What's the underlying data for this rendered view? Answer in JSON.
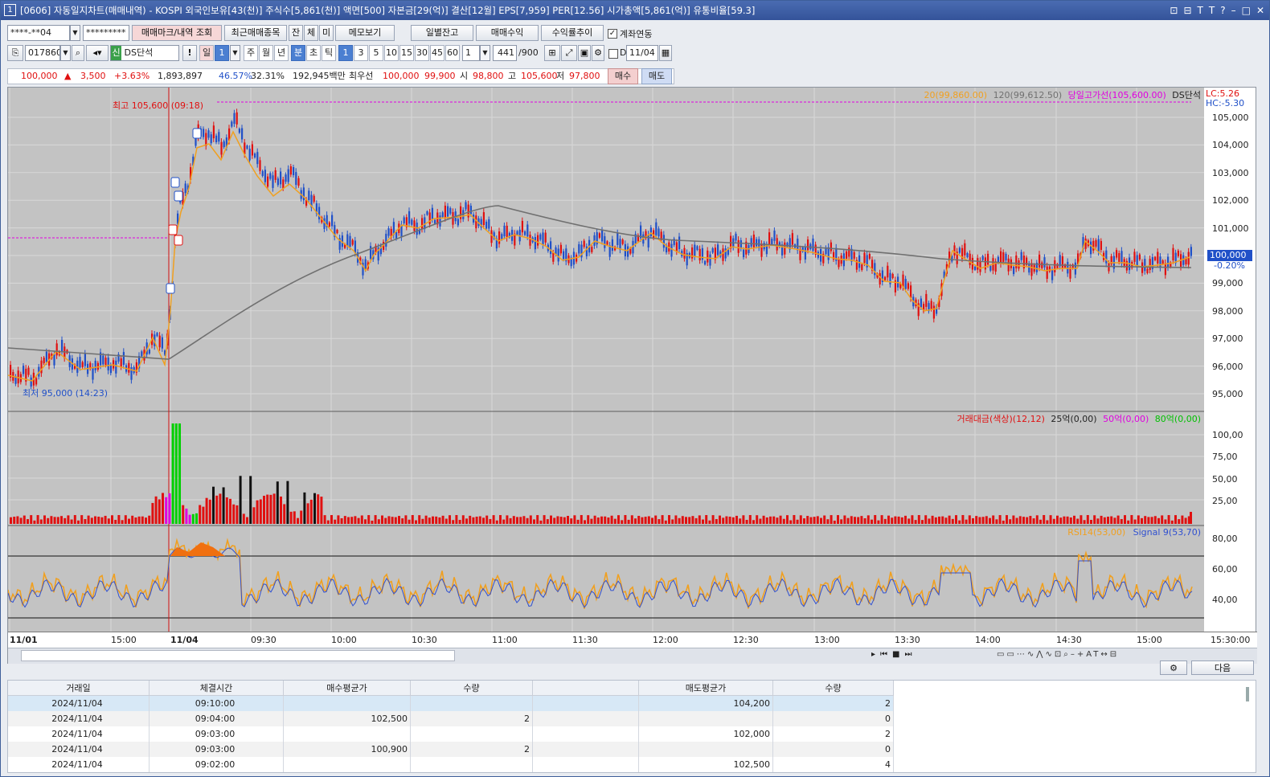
{
  "window": {
    "icon_num": "1",
    "title": "[0606] 자동일지차트(매매내역) - KOSPI 외국인보유[43(천)] 주식수[5,861(천)] 액면[500] 자본금[29(억)] 결산[12월] EPS[7,959] PER[12.56] 시가총액[5,861(억)] 유통비율[59.3]",
    "controls": [
      "⊡",
      "⊟",
      "T",
      "T",
      "?",
      "–",
      "□",
      "✕"
    ]
  },
  "toolbar1": {
    "account": "****-**04",
    "password": "*********",
    "buttons": [
      "매매마크/내역 조회",
      "최근매매종목",
      "잔",
      "체",
      "미",
      "메모보기"
    ],
    "right_buttons": [
      "일별잔고",
      "매매수익",
      "수익률추이"
    ],
    "link_label": "계좌연동",
    "link_checked": true
  },
  "toolbar2": {
    "code": "017860",
    "name": "DS단석",
    "name_badge": "신",
    "excl": "!",
    "periods": [
      "일",
      "1",
      "주",
      "월",
      "년",
      "분",
      "초",
      "틱"
    ],
    "active_period": "분",
    "minute_opts": [
      "1",
      "3",
      "5",
      "10",
      "15",
      "30",
      "45",
      "60"
    ],
    "active_minute": "1",
    "step": "1",
    "count": "441",
    "count_total": "/900",
    "d_label": "D",
    "date": "11/04"
  },
  "quote": {
    "price": "100,000",
    "arrow": "▲",
    "change": "3,500",
    "rate": "+3.63%",
    "volume": "1,893,897",
    "vol_ratio": "46.57%",
    "turnover": "32.31%",
    "amount": "192,945백만",
    "best_label": "최우선",
    "ask": "100,000",
    "bid": "99,900",
    "open_label": "시",
    "open": "98,800",
    "high_label": "고",
    "high": "105,600",
    "low_label": "저",
    "low": "97,800",
    "buy_btn": "매수",
    "sell_btn": "매도"
  },
  "chart": {
    "price_axis": [
      "105,000",
      "104,000",
      "103,000",
      "102,000",
      "101,000",
      "100,000",
      "99,000",
      "98,000",
      "97,000",
      "96,000",
      "95,000"
    ],
    "price_now": "100,000",
    "price_now_pct": "-0.20%",
    "lc_label": "LC:5.26",
    "hc_label": "HC:-5.30",
    "legend_ma20": "20(99,860.00)",
    "legend_ma120": "120(99,612.50)",
    "legend_prevhigh": "당일고가선(105,600.00)",
    "legend_name": "DS단석",
    "high_mark": "최고 105,600 (09:18)",
    "low_mark": "최저 95,000 (14:23)",
    "vol_axis": [
      "100,00",
      "75,00",
      "50,00",
      "25,00"
    ],
    "vol_legend": [
      "거래대금(색상)(12,12)",
      "25억(0,00)",
      "50억(0,00)",
      "80억(0,00)"
    ],
    "rsi_axis": [
      "80,00",
      "60,00",
      "40,00"
    ],
    "rsi_legend": [
      "RSI14(53,00)",
      "Signal 9(53,70)"
    ],
    "x_labels": [
      "11/01",
      "15:00",
      "11/04",
      "09:30",
      "10:00",
      "10:30",
      "11:00",
      "11:30",
      "12:00",
      "12:30",
      "13:00",
      "13:30",
      "14:00",
      "14:30",
      "15:00",
      "15:30:00"
    ],
    "colors": {
      "up": "#e01010",
      "down": "#2050c8",
      "ma20": "#f0a020",
      "ma120": "#707070",
      "rsi": "#f0a020",
      "signal": "#3050d0",
      "magenta": "#e000e0",
      "green": "#00d000"
    }
  },
  "table": {
    "next_btn": "다음",
    "headers": [
      "거래일",
      "체결시간",
      "매수평균가",
      "수량",
      "",
      "매도평균가",
      "수량"
    ],
    "rows": [
      [
        "2024/11/04",
        "09:10:00",
        "",
        "",
        "",
        "104,200",
        "2"
      ],
      [
        "2024/11/04",
        "09:04:00",
        "102,500",
        "2",
        "",
        "",
        "0"
      ],
      [
        "2024/11/04",
        "09:03:00",
        "",
        "",
        "",
        "102,000",
        "2"
      ],
      [
        "2024/11/04",
        "09:03:00",
        "100,900",
        "2",
        "",
        "",
        "0"
      ],
      [
        "2024/11/04",
        "09:02:00",
        "",
        "",
        "",
        "102,500",
        "4"
      ]
    ]
  }
}
